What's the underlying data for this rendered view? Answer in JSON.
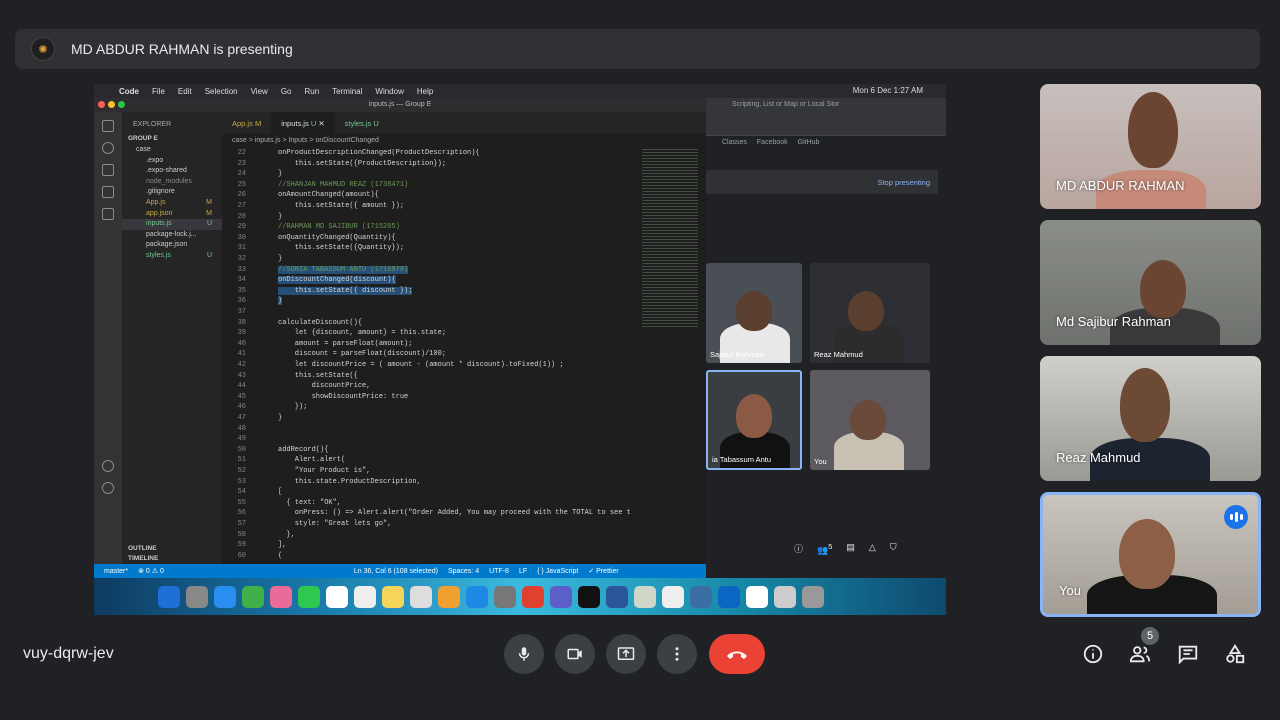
{
  "topbar": {
    "presenting": "MD ABDUR RAHMAN is presenting"
  },
  "mac_menu": {
    "items": [
      "Code",
      "File",
      "Edit",
      "Selection",
      "View",
      "Go",
      "Run",
      "Terminal",
      "Window",
      "Help"
    ],
    "datetime": "Mon 6 Dec  1:27 AM"
  },
  "vscode": {
    "window_title": "inputs.js — Group E",
    "explorer_label": "EXPLORER",
    "section": "GROUP E",
    "files": [
      {
        "name": "case",
        "badge": ""
      },
      {
        "name": ".expo",
        "badge": ""
      },
      {
        "name": ".expo-shared",
        "badge": ""
      },
      {
        "name": "node_modules",
        "badge": ""
      },
      {
        "name": ".gitignore",
        "badge": ""
      },
      {
        "name": "App.js",
        "badge": "M"
      },
      {
        "name": "app.json",
        "badge": "M"
      },
      {
        "name": "inputs.js",
        "badge": "U"
      },
      {
        "name": "package-lock.j...",
        "badge": ""
      },
      {
        "name": "package.json",
        "badge": ""
      },
      {
        "name": "styles.js",
        "badge": "U"
      }
    ],
    "outline": "OUTLINE",
    "timeline": "TIMELINE",
    "tabs": [
      {
        "label": "App.js",
        "badge": "M"
      },
      {
        "label": "inputs.js",
        "badge": "U"
      },
      {
        "label": "styles.js",
        "badge": "U"
      }
    ],
    "breadcrumb": "case  >  inputs.js  >  Inputs  >  onDiscountChanged",
    "code_lines": [
      {
        "n": "22",
        "t": "onProductDescriptionChanged(ProductDescription){"
      },
      {
        "n": "23",
        "t": "    this.setState({ProductDescription});"
      },
      {
        "n": "24",
        "t": "}"
      },
      {
        "n": "25",
        "t": "//SHANJAN MAHMUD REAZ (1738471)"
      },
      {
        "n": "26",
        "t": "onAmountChanged(amount){"
      },
      {
        "n": "27",
        "t": "    this.setState({ amount });"
      },
      {
        "n": "28",
        "t": "}"
      },
      {
        "n": "29",
        "t": "//RAHMAN MD SAJIBUR (1715205)"
      },
      {
        "n": "30",
        "t": "onQuantityChanged(Quantity){"
      },
      {
        "n": "31",
        "t": "    this.setState({Quantity});"
      },
      {
        "n": "32",
        "t": "}"
      },
      {
        "n": "33",
        "t": "//SONIA TABASSUM ANTU (1716978)"
      },
      {
        "n": "34",
        "t": "onDiscountChanged(discount){"
      },
      {
        "n": "35",
        "t": "    this.setState({ discount });"
      },
      {
        "n": "36",
        "t": "}"
      },
      {
        "n": "37",
        "t": ""
      },
      {
        "n": "38",
        "t": "calculateDiscount(){"
      },
      {
        "n": "39",
        "t": "    let {discount, amount} = this.state;"
      },
      {
        "n": "40",
        "t": "    amount = parseFloat(amount);"
      },
      {
        "n": "41",
        "t": "    discount = parseFloat(discount)/100;"
      },
      {
        "n": "42",
        "t": "    let discountPrice = ( amount - (amount * discount).toFixed(1)) ;"
      },
      {
        "n": "43",
        "t": "    this.setState({"
      },
      {
        "n": "44",
        "t": "        discountPrice,"
      },
      {
        "n": "45",
        "t": "        showDiscountPrice: true"
      },
      {
        "n": "46",
        "t": "    });"
      },
      {
        "n": "47",
        "t": "}"
      },
      {
        "n": "48",
        "t": ""
      },
      {
        "n": "49",
        "t": ""
      },
      {
        "n": "50",
        "t": "addRecord(){"
      },
      {
        "n": "51",
        "t": "    Alert.alert("
      },
      {
        "n": "52",
        "t": "    \"Your Product is\","
      },
      {
        "n": "53",
        "t": "    this.state.ProductDescription,"
      },
      {
        "n": "54",
        "t": "["
      },
      {
        "n": "55",
        "t": "  { text: \"OK\","
      },
      {
        "n": "56",
        "t": "    onPress: () => Alert.alert(\"Order Added, You may proceed with the TOTAL to see t"
      },
      {
        "n": "57",
        "t": "    style: \"Great lets go\","
      },
      {
        "n": "58",
        "t": "  },"
      },
      {
        "n": "59",
        "t": "],"
      },
      {
        "n": "60",
        "t": "("
      }
    ],
    "status": {
      "branch": "master*",
      "problems": "⊗ 0  ⚠ 0",
      "position": "Ln 36, Col 6 (108 selected)",
      "spaces": "Spaces: 4",
      "encoding": "UTF-8",
      "eol": "LF",
      "language": "{ } JavaScript",
      "prettier": "✓ Prettier"
    }
  },
  "browser": {
    "tab_title": "Scripting, List or Map or Local Stor",
    "bookmarks": [
      "Classes",
      "Facebook",
      "GitHub"
    ],
    "stop_presenting": "Stop presenting",
    "people_count": "5",
    "tiles": [
      {
        "name": "Sajibur Rahman"
      },
      {
        "name": "Reaz Mahmud"
      },
      {
        "name": "ia Tabassum Antu"
      },
      {
        "name": "You"
      }
    ]
  },
  "side_tiles": [
    {
      "name": "MD ABDUR RAHMAN"
    },
    {
      "name": "Md Sajibur Rahman"
    },
    {
      "name": "Reaz Mahmud"
    },
    {
      "name": "You"
    }
  ],
  "bottom": {
    "meeting_code": "vuy-dqrw-jev",
    "people_count": "5"
  },
  "colors": {
    "end_call": "#ea4335",
    "accent": "#1a73e8",
    "vscode_status": "#007acc"
  }
}
